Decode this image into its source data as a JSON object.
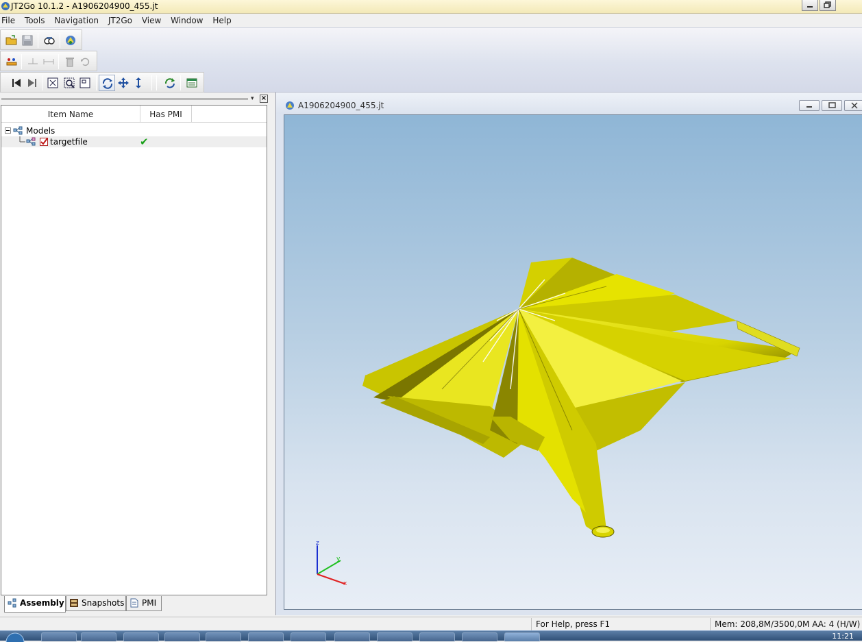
{
  "window": {
    "title": "JT2Go 10.1.2 - A1906204900_455.jt"
  },
  "menu": {
    "items": [
      "File",
      "Tools",
      "Navigation",
      "JT2Go",
      "View",
      "Window",
      "Help"
    ]
  },
  "toolbars": {
    "row1": [
      "open-icon",
      "save-icon",
      "print-preview-icon",
      "jt2go-logo-icon"
    ],
    "row2": [
      "measure-icon",
      "dimension-icon",
      "dimension-linear-icon",
      "delete-icon",
      "undo-icon"
    ],
    "row3": [
      "first-step-icon",
      "last-step-icon",
      "fit-all-icon",
      "zoom-area-icon",
      "zoom-icon",
      "rotate-icon",
      "pan-icon",
      "zoom-vertical-icon",
      "refresh-icon",
      "properties-icon"
    ]
  },
  "assembly_tree": {
    "columns": [
      "Item Name",
      "Has PMI"
    ],
    "rows": [
      {
        "name": "Models",
        "has_pmi": ""
      },
      {
        "name": "targetfile",
        "has_pmi": "✔"
      }
    ]
  },
  "left_tabs": [
    "Assembly",
    "Snapshots",
    "PMI"
  ],
  "document": {
    "title": "A1906204900_455.jt"
  },
  "triad": {
    "x": "x",
    "y": "y",
    "z": "z"
  },
  "colors": {
    "model": "#e3e000",
    "model_dark": "#555200",
    "viewport_top": "#8fb6d6",
    "viewport_bottom": "#e8eef6"
  },
  "status": {
    "help": "For Help, press F1",
    "memory": "Mem: 208,8M/3500,0M  AA: 4 (H/W)"
  },
  "clock": "11:21"
}
